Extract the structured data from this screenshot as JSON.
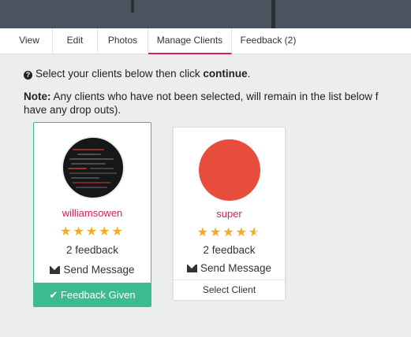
{
  "tabs": [
    {
      "label": "View",
      "active": false
    },
    {
      "label": "Edit",
      "active": false
    },
    {
      "label": "Photos",
      "active": false
    },
    {
      "label": "Manage Clients",
      "active": true
    },
    {
      "label": "Feedback (2)",
      "active": false
    }
  ],
  "instructions": {
    "icon": "question-circle-icon",
    "text_before": "Select your clients below then click ",
    "text_bold": "continue",
    "text_after": "."
  },
  "note": {
    "label": "Note:",
    "line1": " Any clients who have not been selected, will remain in the list below f",
    "line2": "have any drop outs)."
  },
  "clients": [
    {
      "name": "williamsowen",
      "rating": 5,
      "feedback_count": "2 feedback",
      "message_label": "Send Message",
      "action_label": "Feedback Given",
      "selected": true
    },
    {
      "name": "super",
      "rating": 4.5,
      "feedback_count": "2 feedback",
      "message_label": "Send Message",
      "action_label": "Select Client",
      "selected": false
    }
  ],
  "colors": {
    "accent": "#d6205a",
    "success": "#3cbb8f",
    "star": "#f0ad1e",
    "avatar_red": "#e74c3c"
  }
}
